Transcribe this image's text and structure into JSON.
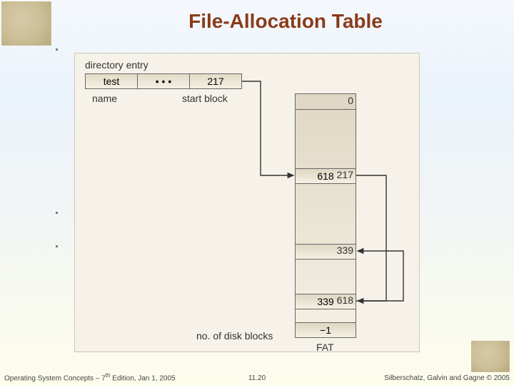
{
  "title": "File-Allocation Table",
  "diagram": {
    "dir_entry_label": "directory entry",
    "dir_cells": {
      "name": "test",
      "dots": "• • •",
      "start": "217"
    },
    "name_label": "name",
    "start_block_label": "start block",
    "fat_indices": {
      "zero": "0",
      "i217": "217",
      "i339": "339",
      "i618": "618"
    },
    "fat_values": {
      "v217": "618",
      "v339": "",
      "v618": "339",
      "vlast": "−1"
    },
    "no_disk_blocks_label": "no. of disk blocks",
    "fat_label": "FAT"
  },
  "footer": {
    "left_a": "Operating System Concepts – 7",
    "left_sup": "th",
    "left_b": " Edition, Jan 1, 2005",
    "center": "11.20",
    "right": "Silberschatz, Galvin and Gagne © 2005"
  }
}
